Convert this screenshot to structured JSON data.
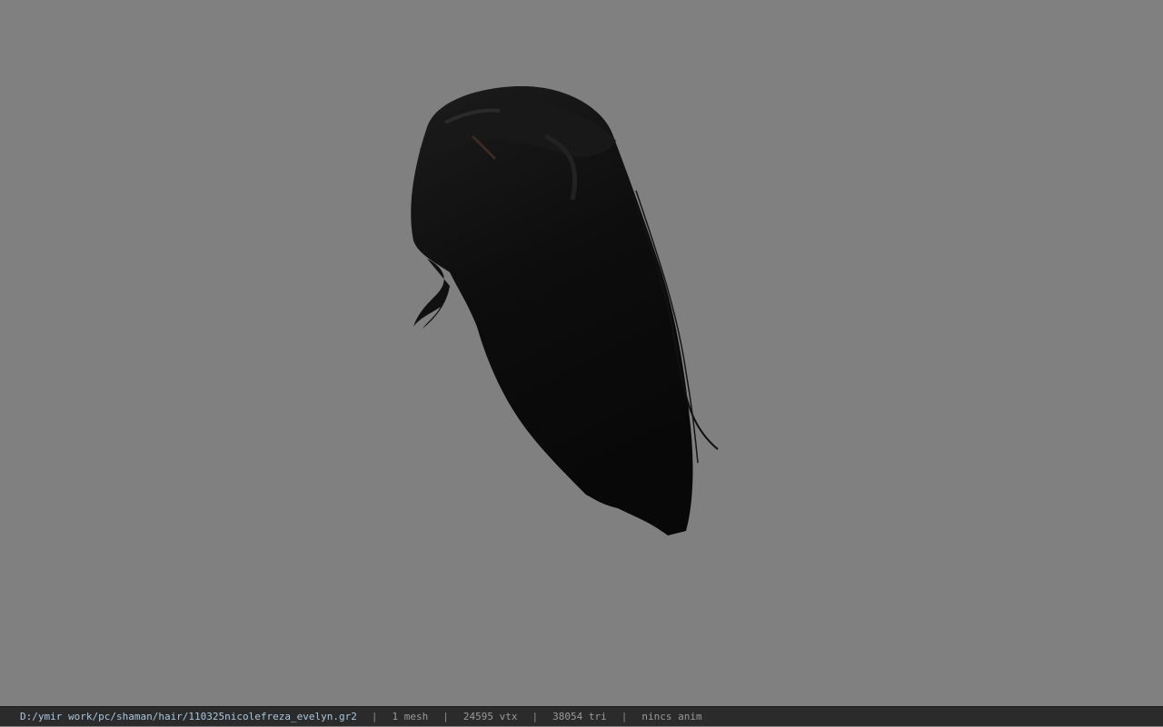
{
  "viewport": {
    "background_color": "#808080",
    "model_icon": "hair-model"
  },
  "status_bar": {
    "file_path": "D:/ymir work/pc/shaman/hair/110325nicolefreza_evelyn.gr2",
    "separator": "|",
    "mesh_count": "1 mesh",
    "vertex_count": "24595 vtx",
    "triangle_count": "38054 tri",
    "animation": "nincs anim",
    "path_color": "#a9c7e0"
  }
}
